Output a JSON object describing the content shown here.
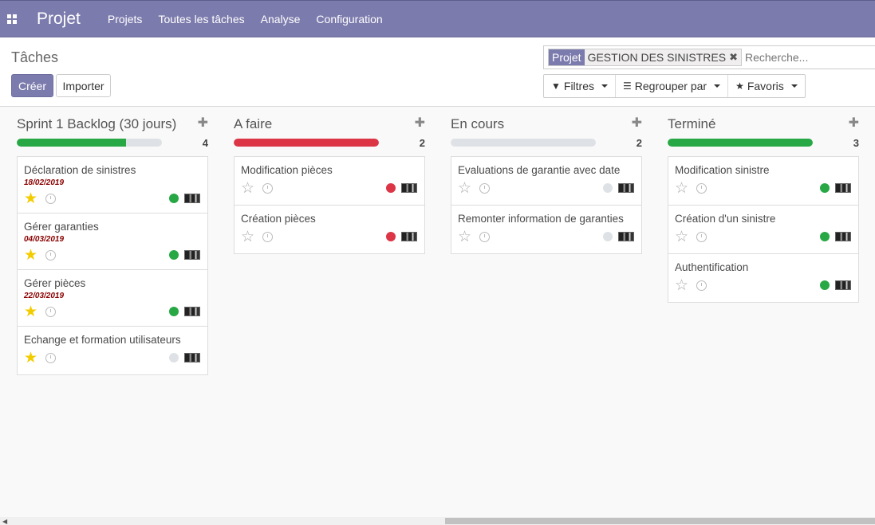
{
  "navbar": {
    "brand": "Projet",
    "menu": [
      "Projets",
      "Toutes les tâches",
      "Analyse",
      "Configuration"
    ]
  },
  "control": {
    "breadcrumb": "Tâches",
    "create_label": "Créer",
    "import_label": "Importer",
    "facet_category": "Projet",
    "facet_value": "GESTION DES SINISTRES",
    "facet_remove": "✖",
    "search_placeholder": "Recherche...",
    "filters_label": "Filtres",
    "group_by_label": "Regrouper par",
    "favorites_label": "Favoris"
  },
  "colors": {
    "accent": "#7c7bad",
    "green": "#28a745",
    "red": "#dc3545",
    "grey": "#dee2e6",
    "star": "#f3cc00",
    "deadline": "#8b0000"
  },
  "columns": [
    {
      "title": "Sprint 1 Backlog (30 jours)",
      "count": "4",
      "progress": [
        {
          "color": "green",
          "fraction": 0.75
        }
      ],
      "cards": [
        {
          "title": "Déclaration de sinistres",
          "date": "18/02/2019",
          "starred": true,
          "status": "green"
        },
        {
          "title": "Gérer garanties",
          "date": "04/03/2019",
          "starred": true,
          "status": "green"
        },
        {
          "title": "Gérer pièces",
          "date": "22/03/2019",
          "starred": true,
          "status": "green"
        },
        {
          "title": "Echange et formation utilisateurs",
          "date": "",
          "starred": true,
          "status": "grey"
        }
      ]
    },
    {
      "title": "A faire",
      "count": "2",
      "progress": [
        {
          "color": "red",
          "fraction": 1.0
        }
      ],
      "cards": [
        {
          "title": "Modification pièces",
          "date": "",
          "starred": false,
          "status": "red"
        },
        {
          "title": "Création pièces",
          "date": "",
          "starred": false,
          "status": "red"
        }
      ]
    },
    {
      "title": "En cours",
      "count": "2",
      "progress": [],
      "cards": [
        {
          "title": "Evaluations de garantie avec date",
          "date": "",
          "starred": false,
          "status": "grey"
        },
        {
          "title": "Remonter information de garanties",
          "date": "",
          "starred": false,
          "status": "grey"
        }
      ]
    },
    {
      "title": "Terminé",
      "count": "3",
      "progress": [
        {
          "color": "green",
          "fraction": 1.0
        }
      ],
      "cards": [
        {
          "title": "Modification sinistre",
          "date": "",
          "starred": false,
          "status": "green"
        },
        {
          "title": "Création d'un sinistre",
          "date": "",
          "starred": false,
          "status": "green"
        },
        {
          "title": "Authentification",
          "date": "",
          "starred": false,
          "status": "green"
        }
      ]
    }
  ]
}
